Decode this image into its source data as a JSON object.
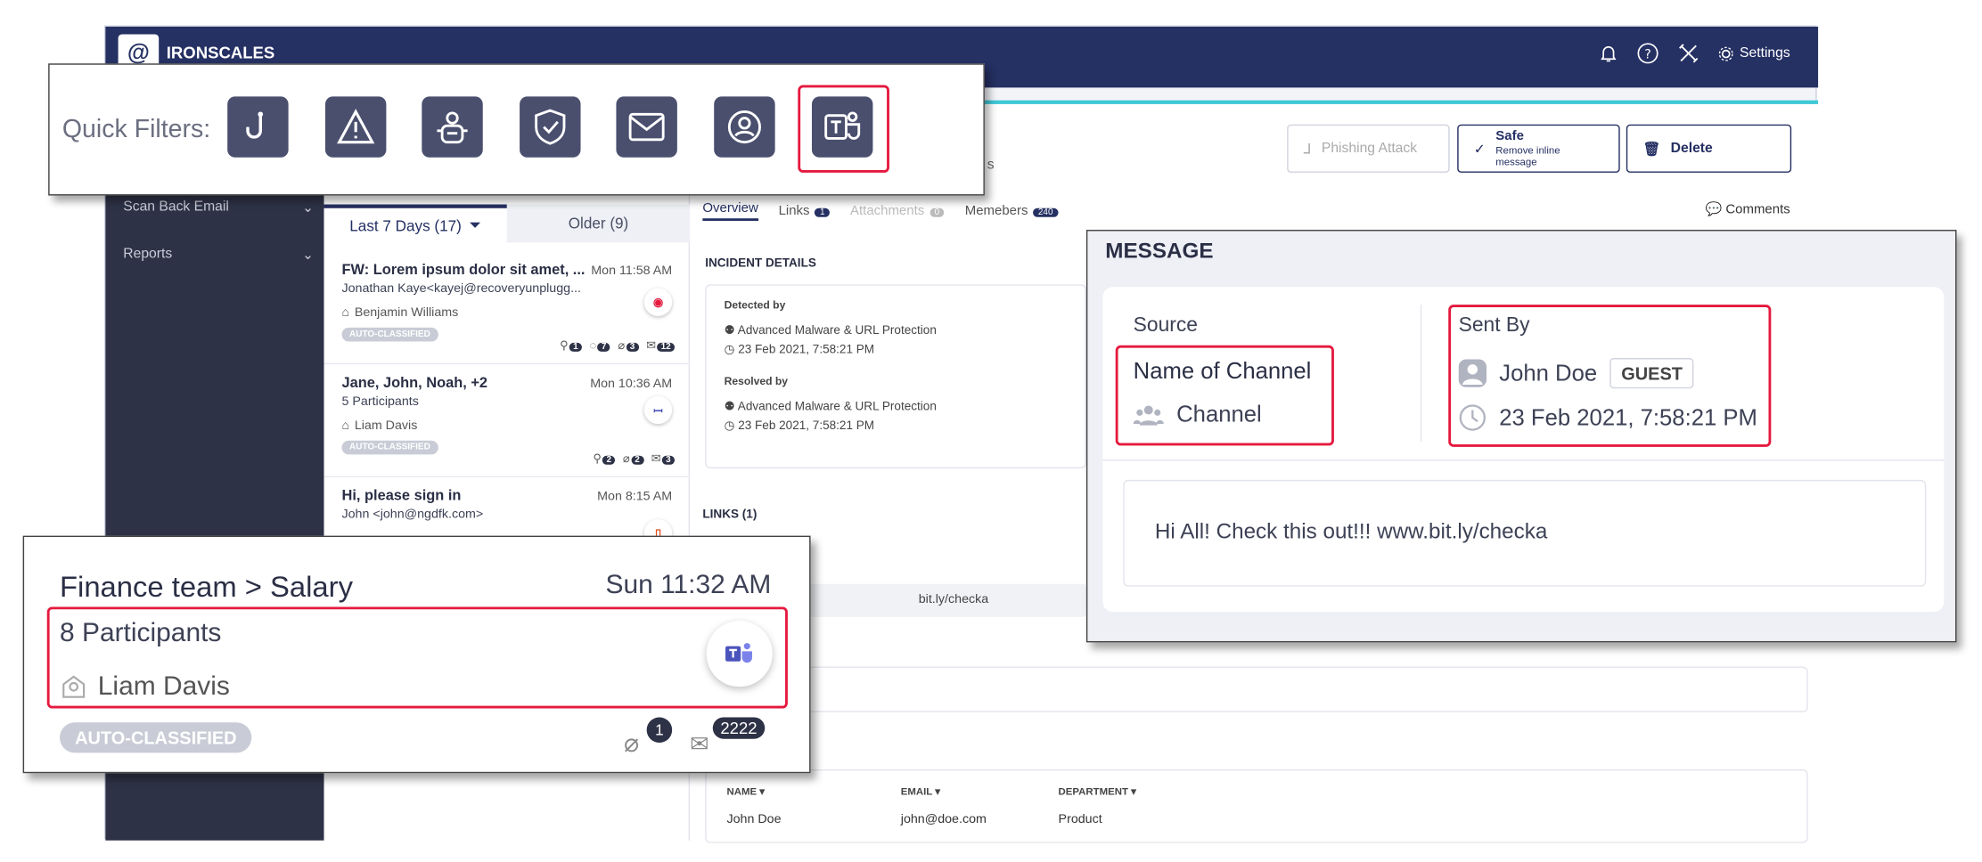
{
  "app": {
    "logo_text": "IRONSCALES",
    "settings_label": "Settings",
    "sidebar": [
      {
        "label": "Scan Back Email"
      },
      {
        "label": "Reports"
      }
    ],
    "list_tabs": {
      "recent": "Last 7 Days (17)",
      "older": "Older (9)"
    },
    "incidents": [
      {
        "subject": "FW: Lorem ipsum dolor sit amet, ...",
        "time": "Mon 11:58 AM",
        "from": "Jonathan Kaye<kayej@recoveryunplugg...",
        "assignee": "Benjamin Williams",
        "badge": "AUTO-CLASSIFIED",
        "channel_icon": "alert-icon",
        "counts": [
          "1",
          "7",
          "3",
          "12"
        ]
      },
      {
        "subject": "Jane, John, Noah, +2",
        "time": "Mon 10:36 AM",
        "from": "5 Participants",
        "assignee": "Liam Davis",
        "badge": "AUTO-CLASSIFIED",
        "channel_icon": "teams-icon",
        "counts": [
          "2",
          "2",
          "3"
        ]
      },
      {
        "subject": "Hi, please sign in",
        "time": "Mon 8:15 AM",
        "from": "John <john@ngdfk.com>",
        "channel_icon": "office-icon"
      }
    ],
    "actions": {
      "phishing": "Phishing Attack",
      "safe": "Safe",
      "safe_sub": "Remove inline message",
      "delete": "Delete"
    },
    "title_fragment": "s",
    "subtabs": {
      "overview": "Overview",
      "links": "Links",
      "links_count": "1",
      "attachments": "Attachments",
      "attachments_count": "0",
      "members": "Memebers",
      "members_count": "240"
    },
    "comments": "Comments",
    "incident_details": {
      "heading": "INCIDENT DETAILS",
      "detected_label": "Detected by",
      "detected_by": "Advanced Malware & URL Protection",
      "detected_time": "23 Feb 2021, 7:58:21 PM",
      "resolved_label": "Resolved by",
      "resolved_by": "Advanced Malware & URL Protection",
      "resolved_time": "23 Feb 2021, 7:58:21 PM"
    },
    "links_heading": "LINKS (1)",
    "link_fragment": "bit.ly/checka",
    "members_table": {
      "columns": [
        "NAME",
        "EMAIL",
        "DEPARTMENT"
      ],
      "rows": [
        [
          "John Doe",
          "john@doe.com",
          "Product"
        ]
      ]
    }
  },
  "quick_filters": {
    "label": "Quick Filters:",
    "buttons": [
      "hook-icon",
      "warning-icon",
      "bug-icon",
      "shield-check-icon",
      "mail-icon",
      "user-target-icon",
      "teams-icon"
    ],
    "highlighted": "teams-icon"
  },
  "finance_card": {
    "subject": "Finance team > Salary",
    "time": "Sun 11:32 AM",
    "participants": "8 Participants",
    "assignee": "Liam Davis",
    "badge": "AUTO-CLASSIFIED",
    "attach_count": "1",
    "mail_count": "2222"
  },
  "message_panel": {
    "heading": "MESSAGE",
    "source_label": "Source",
    "channel_name_label": "Name of Channel",
    "channel": "Channel",
    "sent_by_label": "Sent By",
    "sender": "John Doe",
    "sender_badge": "GUEST",
    "sent_time": "23 Feb 2021, 7:58:21 PM",
    "body": "Hi All! Check this out!!! www.bit.ly/checka"
  },
  "colors": {
    "navy": "#253063",
    "sidebar": "#2e3246",
    "highlight": "#e5193e",
    "accent_teal": "#3fc8d6"
  }
}
